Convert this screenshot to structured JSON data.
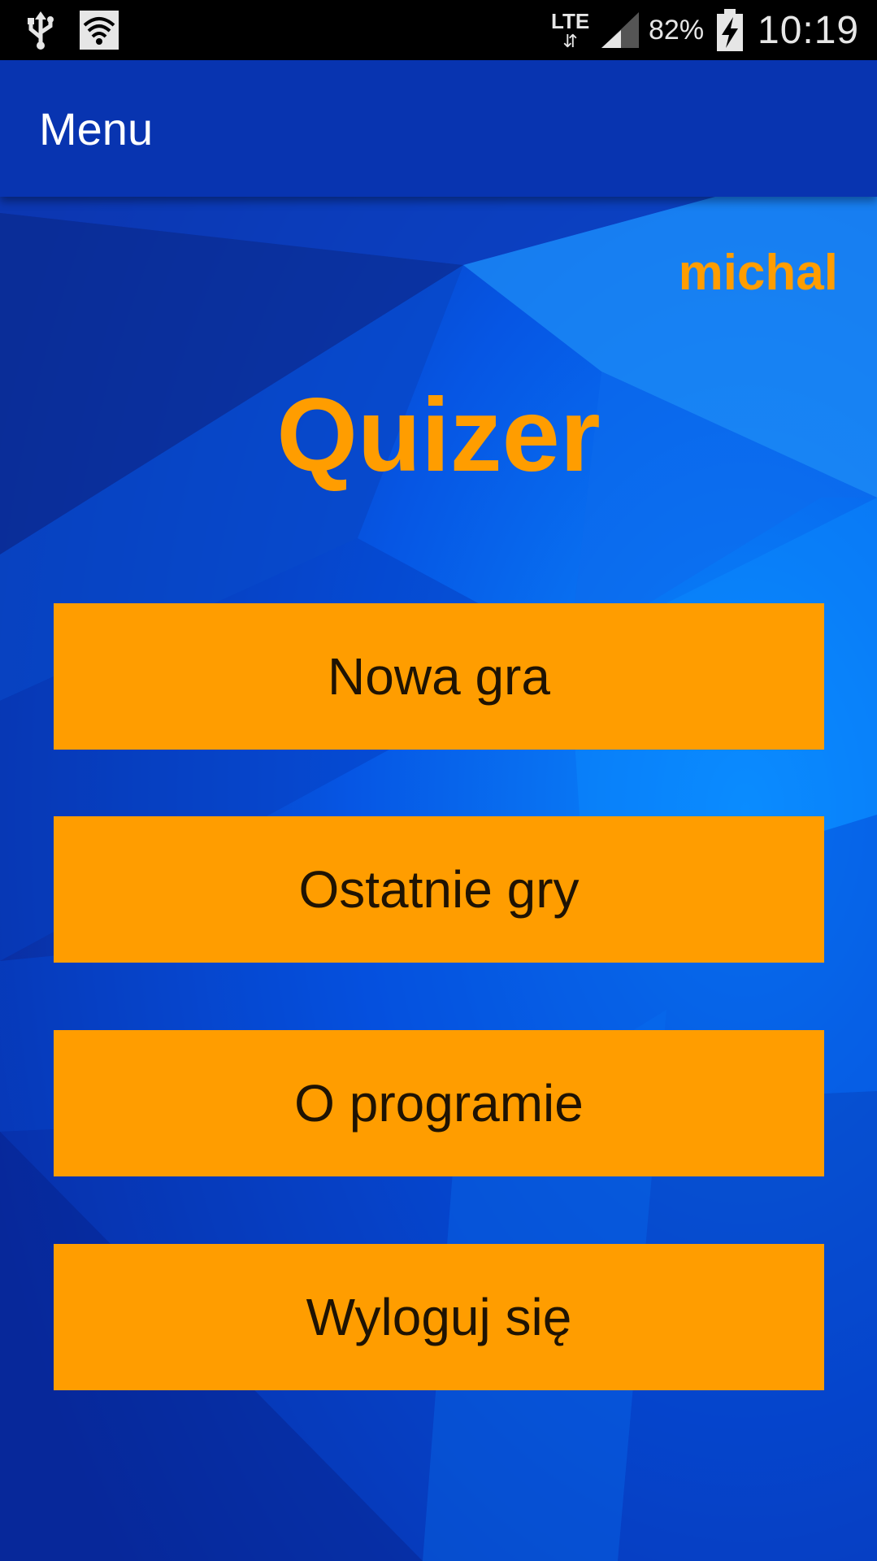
{
  "status_bar": {
    "usb_icon": "usb-icon",
    "wifi_icon": "wifi-icon",
    "network_label": "LTE",
    "battery_percent": "82%",
    "time": "10:19"
  },
  "app_bar": {
    "title": "Menu",
    "color": "#0834b0"
  },
  "main": {
    "username": "michal",
    "app_title": "Quizer",
    "accent_color": "#ff9d00",
    "buttons": [
      {
        "label": "Nowa gra"
      },
      {
        "label": "Ostatnie gry"
      },
      {
        "label": "O programie"
      },
      {
        "label": "Wyloguj się"
      }
    ]
  }
}
